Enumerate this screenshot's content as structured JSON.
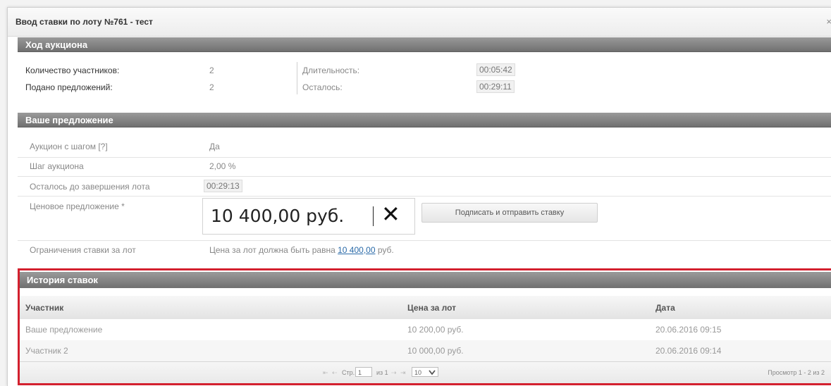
{
  "dialog": {
    "title": "Ввод ставки по лоту №761 - тест",
    "close_label": "×"
  },
  "auction_progress": {
    "heading": "Ход аукциона",
    "participants_label": "Количество участников:",
    "participants_value": "2",
    "offers_label": "Подано предложений:",
    "offers_value": "2",
    "duration_label": "Длительность:",
    "duration_value": "00:05:42",
    "remaining_label": "Осталось:",
    "remaining_value": "00:29:11"
  },
  "your_offer": {
    "heading": "Ваше предложение",
    "step_auction_label": "Аукцион с шагом [?]",
    "step_auction_value": "Да",
    "step_label": "Шаг аукциона",
    "step_value": "2,00 %",
    "lot_remaining_label": "Осталось до завершения лота",
    "lot_remaining_value": "00:29:13",
    "price_label": "Ценовое предложение *",
    "price_value": "10 400,00 руб.",
    "clear_icon": "✕",
    "sign_button": "Подписать и отправить ставку",
    "limits_label": "Ограничения ставки за лот",
    "limits_text_prefix": "Цена за лот должна быть равна",
    "limits_amount": "10 400,00",
    "limits_text_suffix": "руб."
  },
  "history": {
    "heading": "История ставок",
    "columns": [
      "Участник",
      "Цена за лот",
      "Дата"
    ],
    "rows": [
      [
        "Ваше предложение",
        "10 200,00 руб.",
        "20.06.2016 09:15"
      ],
      [
        "Участник 2",
        "10 000,00 руб.",
        "20.06.2016 09:14"
      ]
    ],
    "pager": {
      "first": "⇤",
      "prev": "⇠",
      "page_label": "Стр.",
      "page_value": "1",
      "of_label": "из 1",
      "next": "⇢",
      "last": "⇥",
      "per_page": "10",
      "summary": "Просмотр 1 - 2 из 2"
    }
  }
}
